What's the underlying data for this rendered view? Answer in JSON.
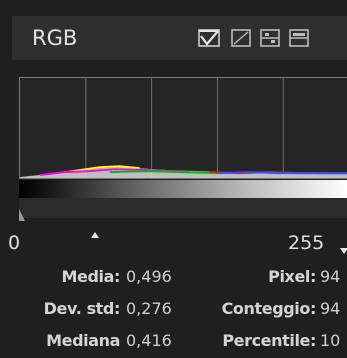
{
  "channel": {
    "selected": "RGB"
  },
  "toolbar": {
    "icons": [
      "linear-histogram-icon",
      "logarithmic-histogram-icon",
      "view-mode-icon",
      "view-mode-alt-icon"
    ]
  },
  "histogram": {
    "colors": {
      "background": "#252525",
      "grid": "#7a7a7a",
      "accent": "#ff00ff"
    }
  },
  "range": {
    "min": "0",
    "max": "255"
  },
  "stats": {
    "mean_label": "Media:",
    "mean_value": "0,496",
    "stddev_label": "Dev. std:",
    "stddev_value": "0,276",
    "median_label": "Mediana",
    "median_value": "0,416",
    "pixels_label": "Pixel:",
    "pixels_value": "94",
    "count_label": "Conteggio:",
    "count_value": "94",
    "percentile_label": "Percentile:",
    "percentile_value": "10"
  }
}
